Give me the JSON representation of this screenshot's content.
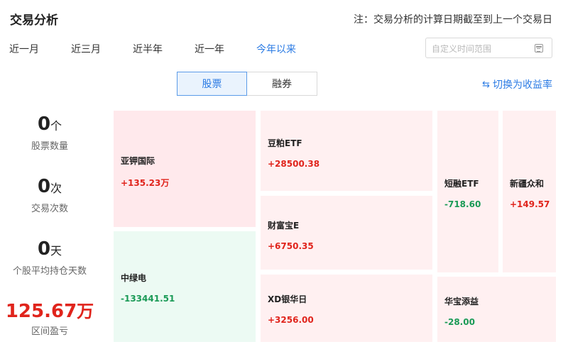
{
  "header": {
    "title": "交易分析",
    "note": "注：交易分析的计算日期截至到上一个交易日"
  },
  "periods": [
    "近一月",
    "近三月",
    "近半年",
    "近一年",
    "今年以来"
  ],
  "range": {
    "placeholder": "自定义时间范围"
  },
  "segments": [
    "股票",
    "融券"
  ],
  "switch_label": "切换为收益率",
  "stats": [
    {
      "value": "0",
      "unit": "个",
      "label": "股票数量"
    },
    {
      "value": "0",
      "unit": "次",
      "label": "交易次数"
    },
    {
      "value": "0",
      "unit": "天",
      "label": "个股平均持仓天数"
    },
    {
      "value": "125.67",
      "unit": "万",
      "label": "区间盈亏"
    }
  ],
  "tiles": [
    {
      "name": "亚钾国际",
      "value": "+135.23万"
    },
    {
      "name": "中绿电",
      "value": "-133441.51"
    },
    {
      "name": "豆粕ETF",
      "value": "+28500.38"
    },
    {
      "name": "财富宝E",
      "value": "+6750.35"
    },
    {
      "name": "XD银华日",
      "value": "+3256.00"
    },
    {
      "name": "短融ETF",
      "value": "-718.60"
    },
    {
      "name": "新疆众和",
      "value": "+149.57"
    },
    {
      "name": "华宝添益",
      "value": "-28.00"
    }
  ],
  "colors": {
    "accent": "#2b7be4",
    "gain": "#e0241c",
    "loss": "#1a9a56"
  }
}
